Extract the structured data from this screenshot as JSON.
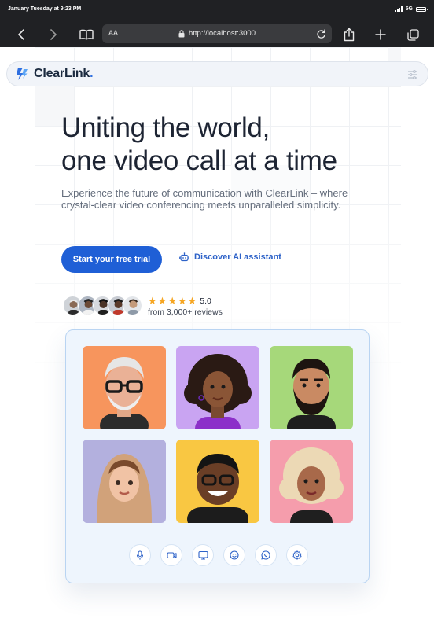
{
  "status_bar": {
    "time": "January Tuesday at 9:23 PM",
    "network": "5G"
  },
  "browser": {
    "text_size_label": "AA",
    "url": "http://localhost:3000",
    "icons": [
      "back-icon",
      "forward-icon",
      "book-icon",
      "lock-icon",
      "reload-icon",
      "share-icon",
      "plus-icon",
      "tabs-icon"
    ]
  },
  "header": {
    "logo_text": "ClearLink",
    "logo_dot": ".",
    "menu_icon": "sliders-icon"
  },
  "hero": {
    "title_line1": "Uniting the world,",
    "title_line2": "one video call at a time",
    "description": "Experience the future of communication with ClearLink – where crystal-clear video conferencing meets unparalleled simplicity.",
    "cta_label": "Start your free trial",
    "ai_link_label": "Discover AI assistant",
    "ai_icon": "robot-icon"
  },
  "reviews": {
    "stars": 5,
    "rating": "5.0",
    "count_text": "from 3,000+ reviews"
  },
  "video_call": {
    "participants": [
      {
        "name": "participant-1",
        "bg": "#f7955d"
      },
      {
        "name": "participant-2",
        "bg": "#c9a4f2"
      },
      {
        "name": "participant-3",
        "bg": "#a6d87a"
      },
      {
        "name": "participant-4",
        "bg": "#b3b0de"
      },
      {
        "name": "participant-5",
        "bg": "#f9c742"
      },
      {
        "name": "participant-6",
        "bg": "#f59dac"
      }
    ],
    "controls": [
      "microphone-icon",
      "camera-icon",
      "screen-share-icon",
      "emoji-icon",
      "chat-icon",
      "settings-icon"
    ]
  },
  "colors": {
    "accent": "#1f5fd6",
    "star": "#f6a623",
    "card_bg": "#eef5fd"
  }
}
